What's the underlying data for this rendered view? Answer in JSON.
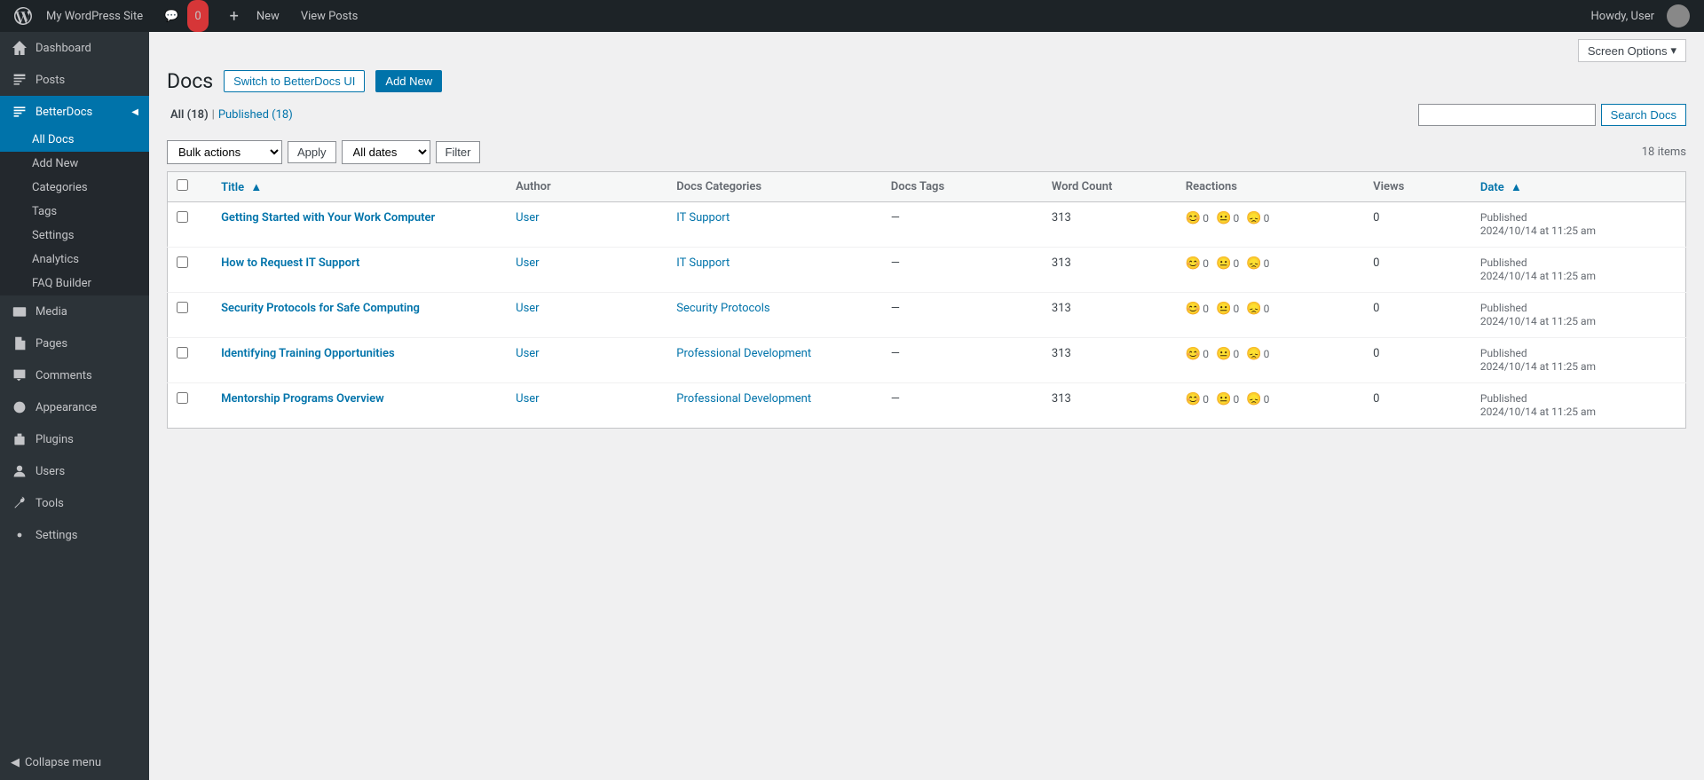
{
  "adminBar": {
    "siteName": "My WordPress Site",
    "commentsCount": "0",
    "newLabel": "New",
    "viewPostsLabel": "View Posts",
    "howdyLabel": "Howdy, User"
  },
  "screenOptions": {
    "label": "Screen Options",
    "arrow": "▾"
  },
  "page": {
    "title": "Docs",
    "switchButton": "Switch to BetterDocs UI",
    "addNewButton": "Add New"
  },
  "filterLinks": {
    "all": "All",
    "allCount": "18",
    "published": "Published",
    "publishedCount": "18"
  },
  "search": {
    "placeholder": "",
    "buttonLabel": "Search Docs"
  },
  "toolbar": {
    "bulkActionsLabel": "Bulk actions",
    "applyLabel": "Apply",
    "allDatesLabel": "All dates",
    "filterLabel": "Filter",
    "itemCount": "18 items"
  },
  "table": {
    "columns": {
      "title": "Title",
      "author": "Author",
      "docsCategories": "Docs Categories",
      "docsTags": "Docs Tags",
      "wordCount": "Word Count",
      "reactions": "Reactions",
      "views": "Views",
      "date": "Date"
    },
    "rows": [
      {
        "title": "Getting Started with Your Work Computer",
        "author": "User",
        "categories": "IT Support",
        "tags": "—",
        "wordCount": "313",
        "reactions": [
          {
            "emoji": "😊",
            "count": "0"
          },
          {
            "emoji": "😐",
            "count": "0"
          },
          {
            "emoji": "😞",
            "count": "0"
          }
        ],
        "views": "0",
        "status": "Published",
        "date": "2024/10/14 at 11:25 am"
      },
      {
        "title": "How to Request IT Support",
        "author": "User",
        "categories": "IT Support",
        "tags": "—",
        "wordCount": "313",
        "reactions": [
          {
            "emoji": "😊",
            "count": "0"
          },
          {
            "emoji": "😐",
            "count": "0"
          },
          {
            "emoji": "😞",
            "count": "0"
          }
        ],
        "views": "0",
        "status": "Published",
        "date": "2024/10/14 at 11:25 am"
      },
      {
        "title": "Security Protocols for Safe Computing",
        "author": "User",
        "categories": "Security Protocols",
        "tags": "—",
        "wordCount": "313",
        "reactions": [
          {
            "emoji": "😊",
            "count": "0"
          },
          {
            "emoji": "😐",
            "count": "0"
          },
          {
            "emoji": "😞",
            "count": "0"
          }
        ],
        "views": "0",
        "status": "Published",
        "date": "2024/10/14 at 11:25 am"
      },
      {
        "title": "Identifying Training Opportunities",
        "author": "User",
        "categories": "Professional Development",
        "tags": "—",
        "wordCount": "313",
        "reactions": [
          {
            "emoji": "😊",
            "count": "0"
          },
          {
            "emoji": "😐",
            "count": "0"
          },
          {
            "emoji": "😞",
            "count": "0"
          }
        ],
        "views": "0",
        "status": "Published",
        "date": "2024/10/14 at 11:25 am"
      },
      {
        "title": "Mentorship Programs Overview",
        "author": "User",
        "categories": "Professional Development",
        "tags": "—",
        "wordCount": "313",
        "reactions": [
          {
            "emoji": "😊",
            "count": "0"
          },
          {
            "emoji": "😐",
            "count": "0"
          },
          {
            "emoji": "😞",
            "count": "0"
          }
        ],
        "views": "0",
        "status": "Published",
        "date": "2024/10/14 at 11:25 am"
      }
    ]
  },
  "sidebar": {
    "items": [
      {
        "id": "dashboard",
        "label": "Dashboard",
        "icon": "dashboard"
      },
      {
        "id": "posts",
        "label": "Posts",
        "icon": "posts"
      },
      {
        "id": "betterdocs",
        "label": "BetterDocs",
        "icon": "betterdocs",
        "active": true
      },
      {
        "id": "media",
        "label": "Media",
        "icon": "media"
      },
      {
        "id": "pages",
        "label": "Pages",
        "icon": "pages"
      },
      {
        "id": "comments",
        "label": "Comments",
        "icon": "comments"
      },
      {
        "id": "appearance",
        "label": "Appearance",
        "icon": "appearance"
      },
      {
        "id": "plugins",
        "label": "Plugins",
        "icon": "plugins"
      },
      {
        "id": "users",
        "label": "Users",
        "icon": "users"
      },
      {
        "id": "tools",
        "label": "Tools",
        "icon": "tools"
      },
      {
        "id": "settings",
        "label": "Settings",
        "icon": "settings"
      }
    ],
    "betterdocsSubmenu": [
      {
        "id": "all-docs",
        "label": "All Docs",
        "active": true
      },
      {
        "id": "add-new",
        "label": "Add New"
      },
      {
        "id": "categories",
        "label": "Categories"
      },
      {
        "id": "tags",
        "label": "Tags"
      },
      {
        "id": "settings",
        "label": "Settings"
      },
      {
        "id": "analytics",
        "label": "Analytics"
      },
      {
        "id": "faq-builder",
        "label": "FAQ Builder"
      }
    ],
    "collapseLabel": "Collapse menu"
  }
}
